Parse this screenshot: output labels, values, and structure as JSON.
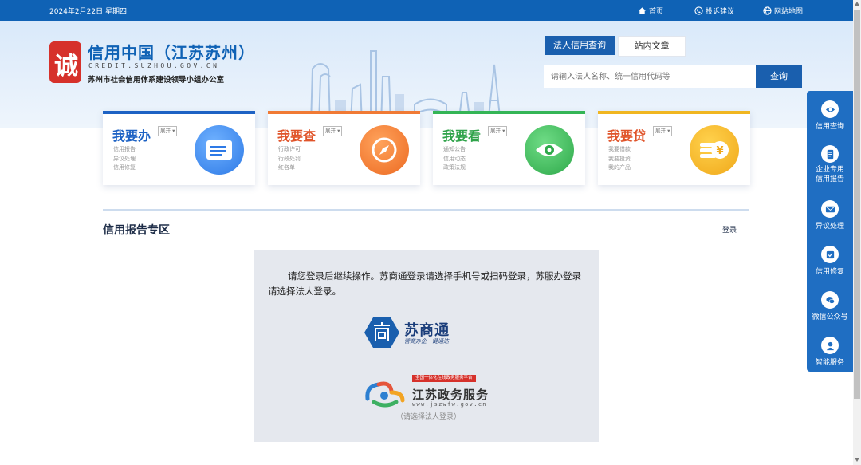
{
  "topbar": {
    "date": "2024年2月22日 星期四",
    "links": [
      {
        "label": "首页",
        "icon": "home-icon"
      },
      {
        "label": "投诉建议",
        "icon": "phone-icon"
      },
      {
        "label": "网站地图",
        "icon": "globe-icon"
      }
    ]
  },
  "brand": {
    "logo_glyph": "诚",
    "title": "信用中国（江苏苏州）",
    "domain": "CREDIT.SUZHOU.GOV.CN",
    "org": "苏州市社会信用体系建设领导小组办公室"
  },
  "search": {
    "tabs": [
      "法人信用查询",
      "站内文章"
    ],
    "active_tab": "法人信用查询",
    "placeholder": "请输入法人名称、统一信用代码等",
    "button_label": "查询"
  },
  "cards": [
    {
      "title": "我要办",
      "expand": "展开",
      "links": [
        "信用报告",
        "异议处理",
        "信用修复"
      ],
      "color": "#1d62c4",
      "icon": "id-card-icon"
    },
    {
      "title": "我要查",
      "expand": "展开",
      "links": [
        "行政许可",
        "行政处罚",
        "红名单"
      ],
      "color": "#e0542a",
      "icon": "compass-icon"
    },
    {
      "title": "我要看",
      "expand": "展开",
      "links": [
        "通知公告",
        "信用动态",
        "政策法规"
      ],
      "color": "#2fa34a",
      "icon": "eye-icon"
    },
    {
      "title": "我要贷",
      "expand": "展开",
      "links": [
        "我要借款",
        "我要投资",
        "我的产品"
      ],
      "color": "#e0542a",
      "icon": "coin-icon"
    }
  ],
  "section": {
    "title": "信用报告专区",
    "login_label": "登录"
  },
  "login_panel": {
    "message": "请您登录后继续操作。苏商通登录请选择手机号或扫码登录，苏服办登录请选择法人登录。",
    "sst": {
      "name": "苏商通",
      "slogan": "营商办企一键通达"
    },
    "jszw": {
      "badge": "全国一体化在线政务服务平台",
      "name": "江苏政务服务",
      "url": "www.jszwfw.gov.cn",
      "hint": "（请选择法人登录）"
    }
  },
  "float_bar": {
    "items": [
      {
        "label": "信用查询",
        "icon": "eye-icon"
      },
      {
        "label": "企业专用信用报告",
        "icon": "document-icon"
      },
      {
        "label": "异议处理",
        "icon": "mail-icon"
      },
      {
        "label": "信用修复",
        "icon": "repair-icon"
      },
      {
        "label": "微信公众号",
        "icon": "wechat-icon"
      },
      {
        "label": "智能服务",
        "icon": "robot-icon"
      }
    ]
  },
  "colors": {
    "primary": "#0f62b5",
    "accent_red": "#d6312b",
    "card_blue": "#1d62c4",
    "card_orange": "#e0542a",
    "card_green": "#2fa34a",
    "card_yellow": "#f0b621"
  }
}
